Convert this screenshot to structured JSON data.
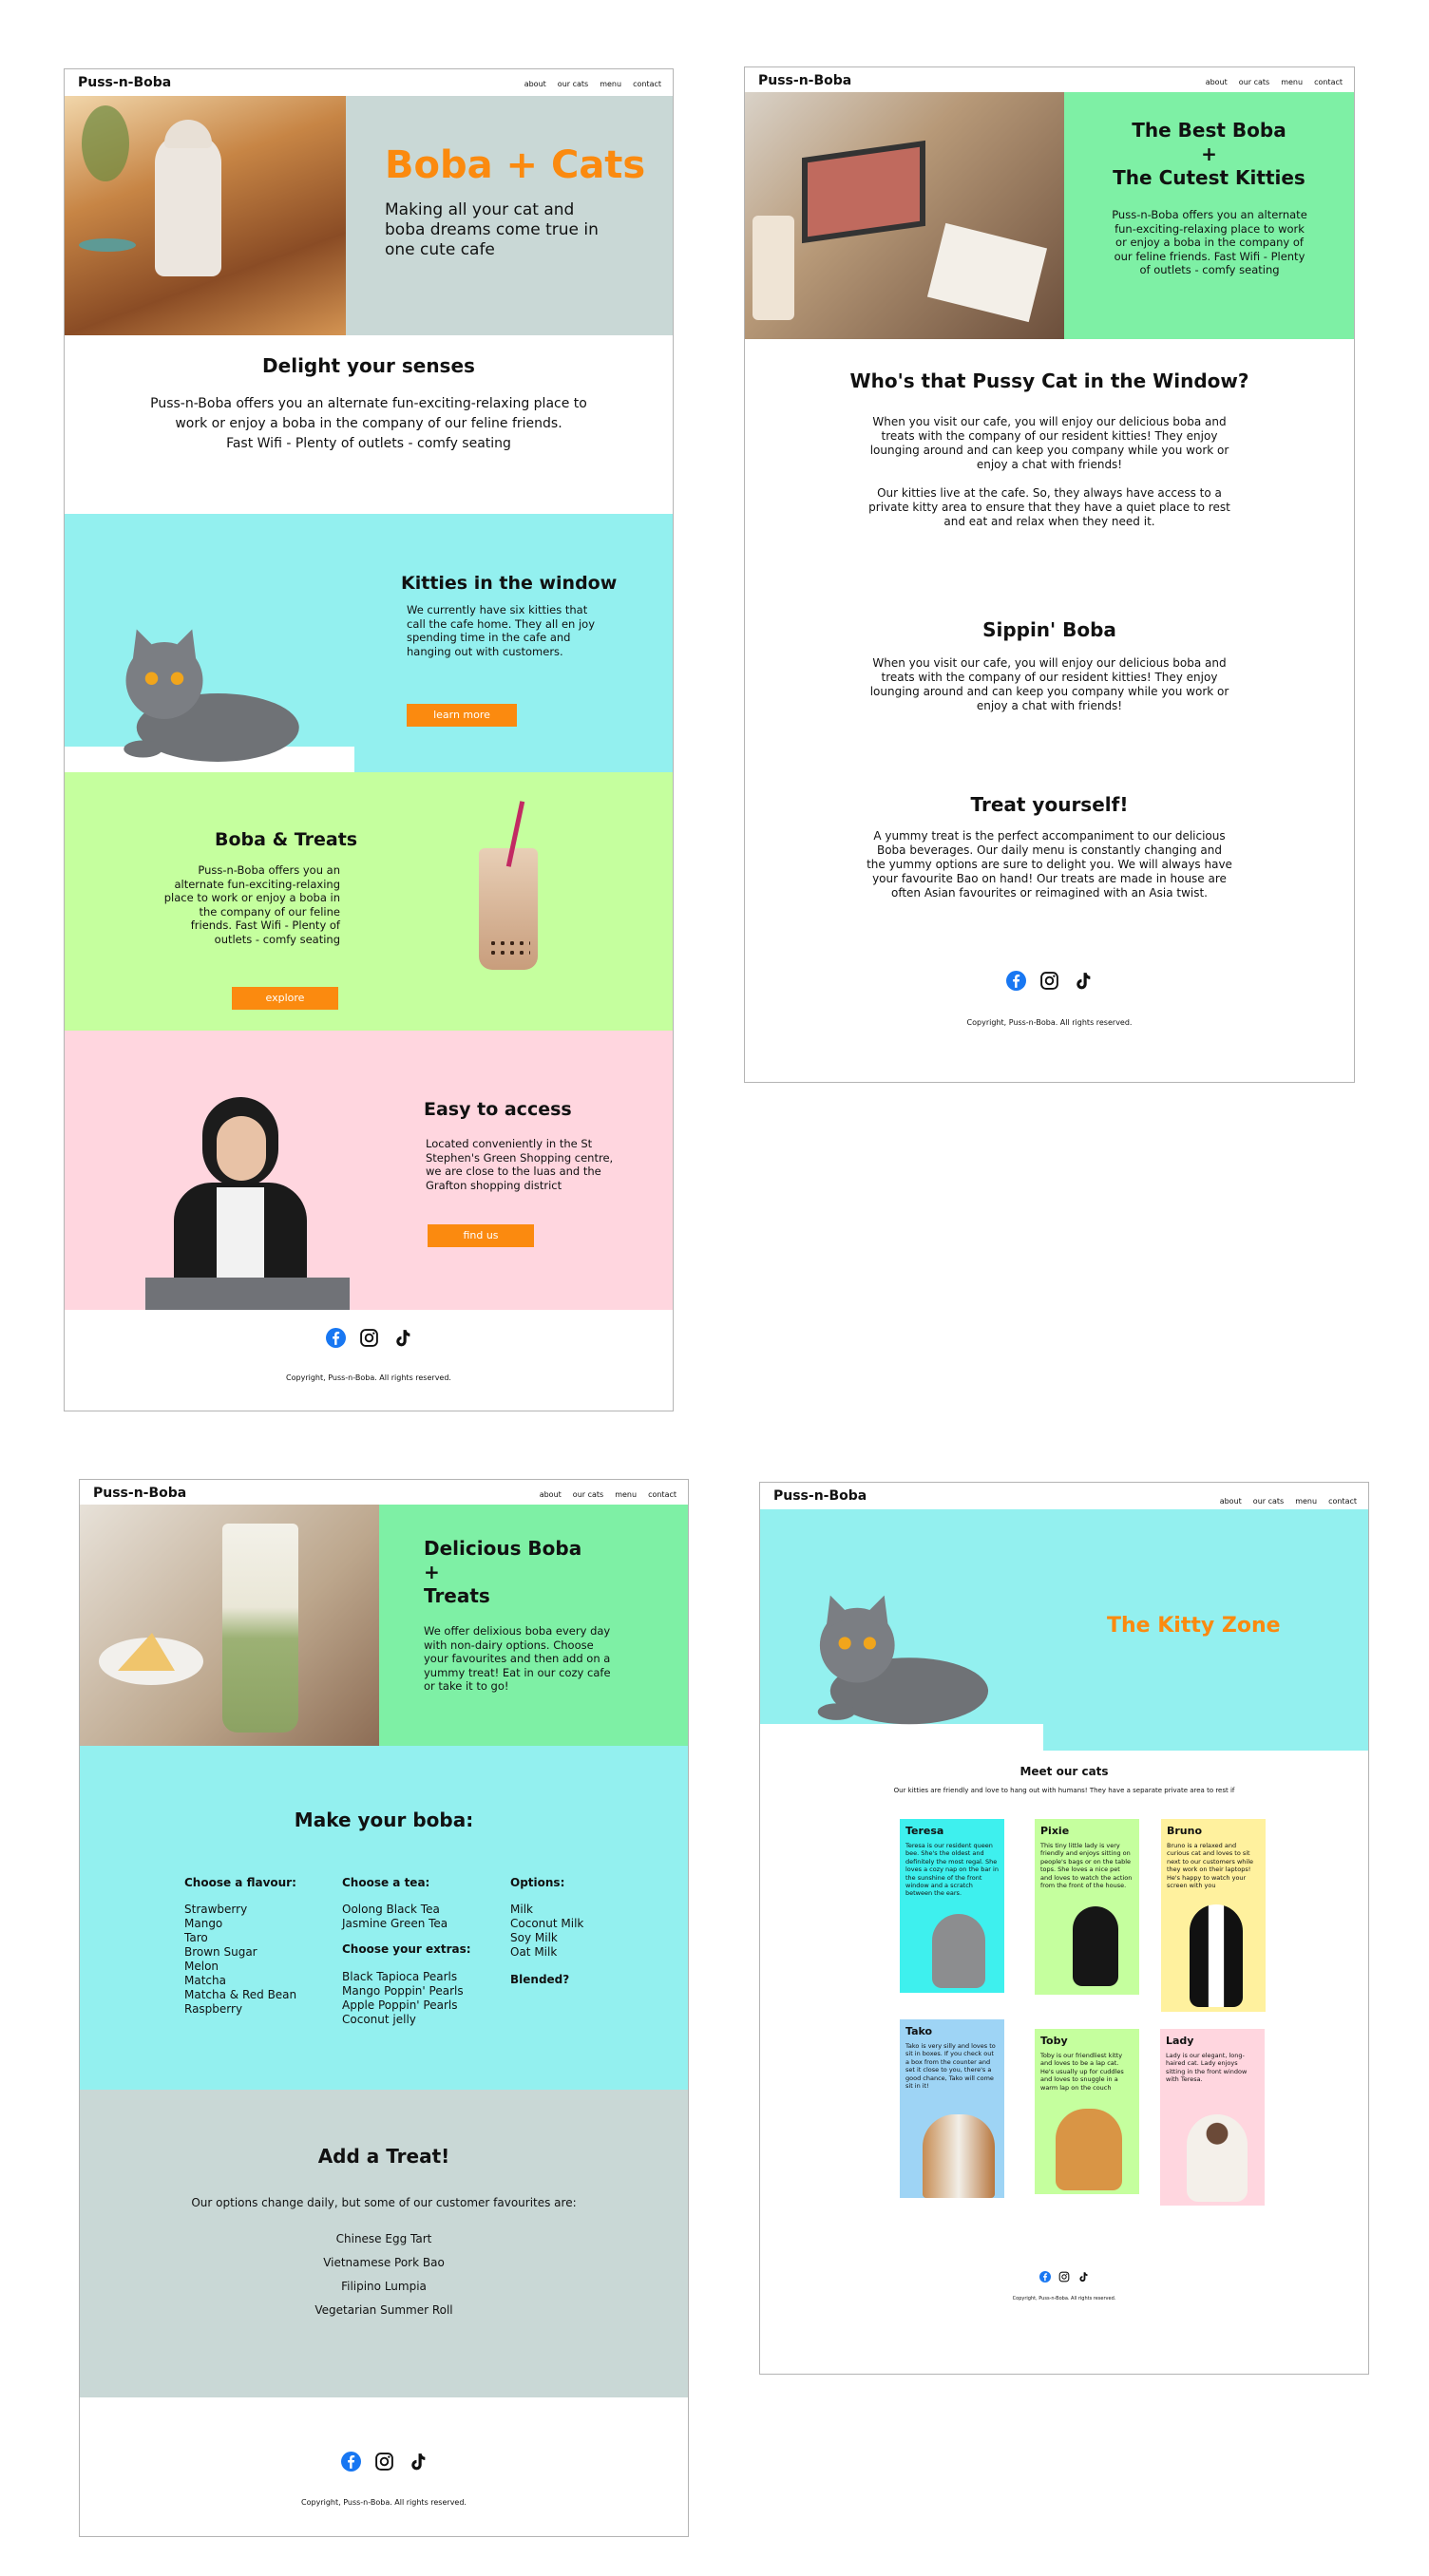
{
  "brand": "Puss-n-Boba",
  "nav": [
    "about",
    "our cats",
    "menu",
    "contact"
  ],
  "copyright": "Copyright, Puss-n-Boba. All rights reserved.",
  "colors": {
    "orange": "#fb8a0f",
    "cyan": "#93f0ef",
    "lime": "#c5ff9e",
    "pink": "#ffd6df",
    "mint": "#7ef0a5",
    "grey": "#c9d8d6",
    "blue": "#1877f2"
  },
  "home": {
    "hero_title": "Boba + Cats",
    "hero_text": "Making all your cat and boba dreams come true in one cute cafe",
    "delight_title": "Delight your senses",
    "delight_text": "Puss-n-Boba offers you an alternate fun-exciting-relaxing place to work or enjoy a boba in the company of our feline friends.",
    "delight_text2": "Fast Wifi - Plenty of outlets - comfy seating",
    "kitties_title": "Kitties in the window",
    "kitties_text": "We currently have six kitties that call the cafe home. They all en joy spending time in the cafe and hanging out with customers.",
    "kitties_button": "learn more",
    "boba_title": "Boba & Treats",
    "boba_text": "Puss-n-Boba offers you an alternate fun-exciting-relaxing place to work or enjoy a boba in the company of our feline friends. Fast Wifi - Plenty of outlets - comfy seating",
    "boba_button": "explore",
    "access_title": "Easy to access",
    "access_text": "Located conveniently in the St Stephen's Green Shopping centre, we are close to the luas and the Grafton shopping district",
    "access_button": "find us"
  },
  "about": {
    "hero_line1": "The Best Boba",
    "hero_plus": "+",
    "hero_line2": "The Cutest Kitties",
    "hero_text": "Puss-n-Boba offers you an alternate fun-exciting-relaxing place to work or enjoy a boba in the company of our feline friends. Fast Wifi - Plenty of outlets - comfy seating",
    "window_title": "Who's that Pussy Cat in the Window?",
    "window_text1": "When you visit our cafe, you will enjoy our delicious boba and treats with the company of our resident kitties! They enjoy lounging around and can keep you company while you work or enjoy a chat with friends!",
    "window_text2": "Our kitties live at the cafe. So, they always have access to a private kitty area to ensure that they have a quiet place to rest and eat and relax when they need it.",
    "sippin_title": "Sippin' Boba",
    "sippin_text": "When you visit our cafe, you will enjoy our delicious boba and treats with the company of our resident kitties! They enjoy lounging around and can keep you company while you work or enjoy a chat with friends!",
    "treat_title": "Treat yourself!",
    "treat_text": "A yummy treat is the perfect accompaniment to our delicious Boba beverages. Our daily menu is constantly changing and the yummy options are sure to delight you. We will always have your favourite Bao on hand! Our treats are made in house are often Asian favourites or reimagined with an Asia twist."
  },
  "menu": {
    "hero_line1": "Delicious Boba",
    "hero_plus": "+",
    "hero_line2": "Treats",
    "hero_text": "We offer delixious boba every day with non-dairy options. Choose your favourites and then add on a yummy treat! Eat in our cozy cafe or take it to go!",
    "make_title": "Make your boba:",
    "flavour_title": "Choose a flavour:",
    "flavours": [
      "Strawberry",
      "Mango",
      "Taro",
      "Brown Sugar",
      "Melon",
      "Matcha",
      "Matcha & Red Bean",
      "Raspberry"
    ],
    "tea_title": "Choose a tea:",
    "teas": [
      "Oolong Black Tea",
      "Jasmine Green Tea"
    ],
    "extras_title": "Choose your extras:",
    "extras": [
      "Black Tapioca Pearls",
      "Mango Poppin' Pearls",
      "Apple Poppin' Pearls",
      "Coconut jelly"
    ],
    "options_title": "Options:",
    "options": [
      "Milk",
      "Coconut Milk",
      "Soy Milk",
      "Oat Milk"
    ],
    "blended": "Blended?",
    "treat_title": "Add a Treat!",
    "treat_intro": "Our options change daily, but some of our customer favourites are:",
    "treats": [
      "Chinese Egg Tart",
      "Vietnamese Pork Bao",
      "Filipino Lumpia",
      "Vegetarian Summer Roll"
    ]
  },
  "cats": {
    "hero_title": "The Kitty Zone",
    "meet_title": "Meet our cats",
    "meet_text": "Our kitties are friendly and love to hang out with humans! They have a separate private area to rest if",
    "cards": [
      {
        "name": "Teresa",
        "text": "Teresa is our resident queen bee. She's the oldest and definitely the most regal. She loves a cozy nap on the bar in the sunshine of the front window and a scratch between the ears."
      },
      {
        "name": "Pixie",
        "text": "This tiny little lady is very friendly and enjoys sitting on people's bags or on the table tops. She loves a nice pet and loves to watch the action from the front of the house."
      },
      {
        "name": "Bruno",
        "text": "Bruno is a relaxed and curious cat and loves to sit next to our customers while they work on their laptops! He's happy to watch your screen with you"
      },
      {
        "name": "Tako",
        "text": "Tako is very silly and loves to sit in boxes. If you check out a box from the counter and set it close to you, there's a good chance, Tako will come sit in it!"
      },
      {
        "name": "Toby",
        "text": "Toby is our friendliest kitty and loves to be a lap cat. He's usually up for cuddles and loves to snuggle in a warm lap on the couch"
      },
      {
        "name": "Lady",
        "text": "Lady is our elegant, long-haired cat. Lady enjoys sitting in the front window with Teresa."
      }
    ]
  }
}
